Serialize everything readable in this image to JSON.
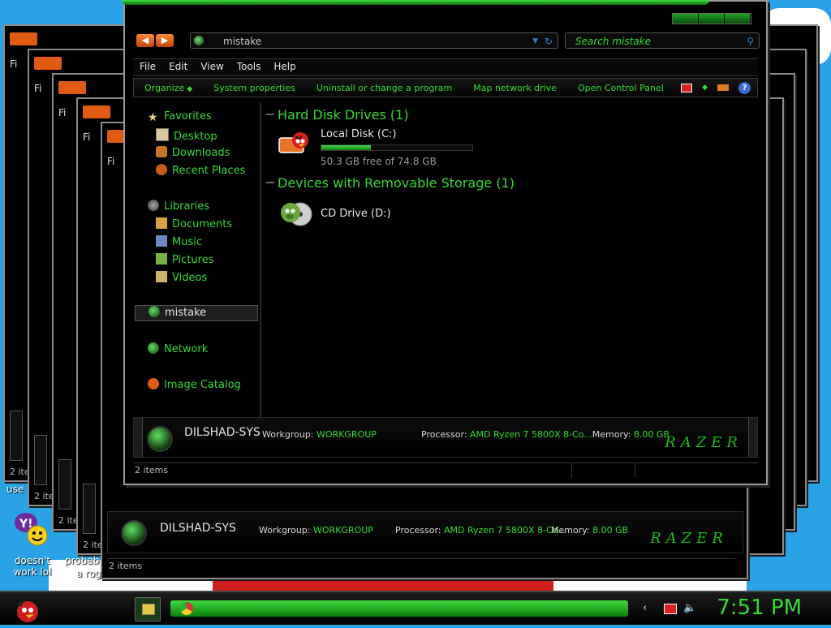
{
  "window": {
    "address": "mistake",
    "search_placeholder": "Search mistake"
  },
  "menu": [
    "File",
    "Edit",
    "View",
    "Tools",
    "Help"
  ],
  "commands": [
    {
      "label": "Organize",
      "dropdown": true
    },
    {
      "label": "System properties",
      "dropdown": false
    },
    {
      "label": "Uninstall or change a program",
      "dropdown": false
    },
    {
      "label": "Map network drive",
      "dropdown": false
    },
    {
      "label": "Open Control Panel",
      "dropdown": false
    }
  ],
  "nav": {
    "favorites": "Favorites",
    "desktop": "Desktop",
    "downloads": "Downloads",
    "recent": "Recent Places",
    "libraries": "Libraries",
    "documents": "Documents",
    "music": "Music",
    "pictures": "Pictures",
    "videos": "Videos",
    "computer": "mistake",
    "network": "Network",
    "image_catalog": "Image Catalog"
  },
  "groups": {
    "hdd": "Hard Disk Drives (1)",
    "removable": "Devices with Removable Storage (1)"
  },
  "drives": {
    "c_name": "Local Disk (C:)",
    "c_free": "50.3 GB free of 74.8 GB",
    "c_used_fraction": 0.33,
    "d_name": "CD Drive (D:)"
  },
  "details": {
    "pc_name": "DILSHAD-SYS",
    "workgroup_label": "Workgroup:",
    "workgroup": "WORKGROUP",
    "processor_label": "Processor:",
    "processor": "AMD Ryzen 7 5800X 8-Co...",
    "memory_label": "Memory:",
    "memory": "8.00 GB",
    "logo": "RAZER"
  },
  "status": "2 items",
  "stack_menu_text": "Fi",
  "desktop": {
    "label_use": "use",
    "label_doesnt_work": "doesn't work lol",
    "label_probably": "probab",
    "label_a_rog": "a rog"
  },
  "taskbar": {
    "clock": "7:51 PM"
  },
  "colors": {
    "accent_green": "#38d838",
    "desktop_blue": "#29a3e6",
    "nav_orange": "#e05a12"
  }
}
